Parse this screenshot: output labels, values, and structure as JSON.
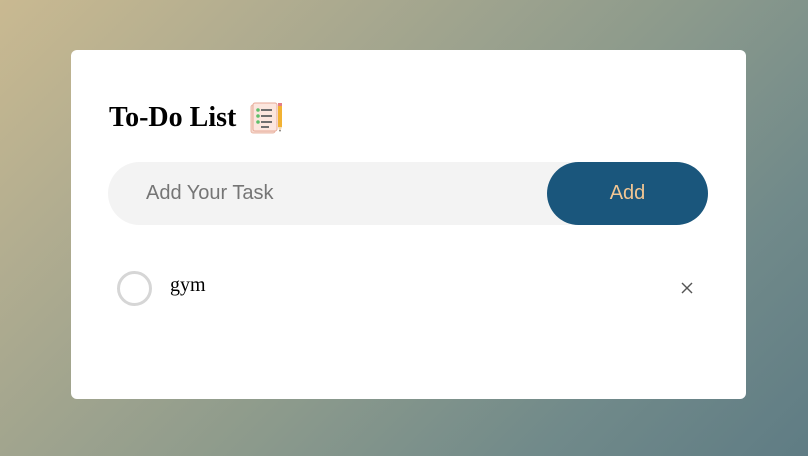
{
  "header": {
    "title": "To-Do List",
    "icon": "checklist-notepad-icon"
  },
  "task_form": {
    "input_value": "",
    "input_placeholder": "Add Your Task",
    "add_label": "Add"
  },
  "tasks": [
    {
      "text": "gym",
      "completed": false
    }
  ],
  "colors": {
    "accent": "#1a567c",
    "button_text": "#f2c693",
    "input_bg": "#f3f3f3",
    "checkbox_border": "#d6d6d6"
  }
}
